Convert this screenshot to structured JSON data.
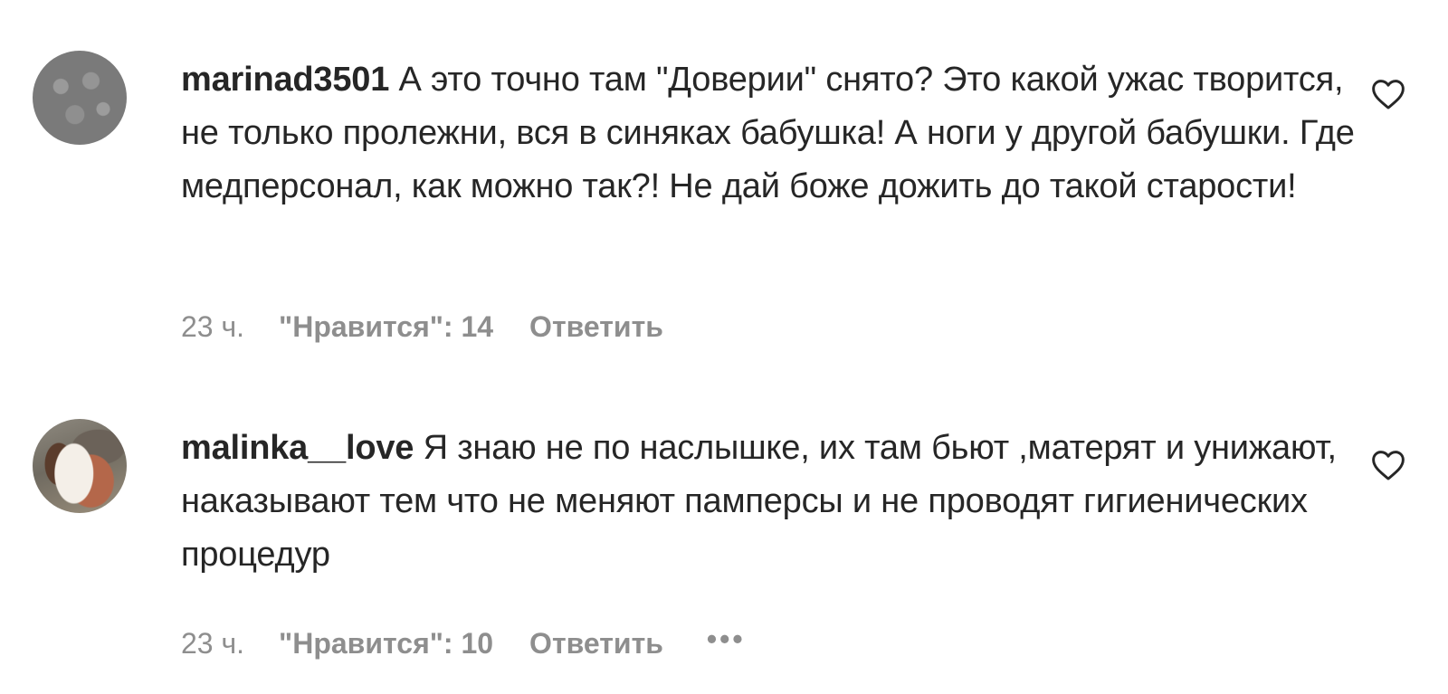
{
  "comments": [
    {
      "username": "marinad3501",
      "text": "А это точно там \"Доверии\" снято? Это какой ужас творится, не только пролежни, вся в синяках бабушка! А ноги у другой бабушки. Где медперсонал, как можно так?! Не дай боже дожить до такой старости!",
      "time": "23 ч.",
      "likes": "\"Нравится\": 14",
      "reply": "Ответить"
    },
    {
      "username": "malinka__love",
      "text": "Я знаю не по наслышке, их там бьют ,матерят и унижают, наказывают тем что не меняют памперсы и не проводят гигиенических процедур",
      "time": "23 ч.",
      "likes": "\"Нравится\": 10",
      "reply": "Ответить",
      "more": "•••"
    }
  ],
  "icons": {
    "like": "heart-outline-icon",
    "more": "more-options-icon"
  },
  "colors": {
    "text": "#262626",
    "meta": "#8e8e8e"
  }
}
